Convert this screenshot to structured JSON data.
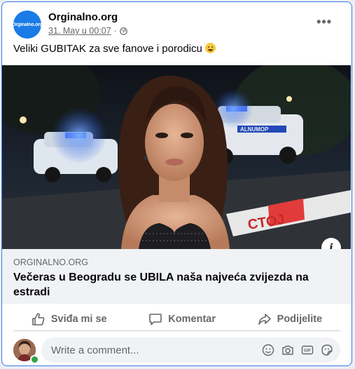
{
  "post": {
    "page_name": "Orginalno.org",
    "avatar_text": "Orginalno.org",
    "timestamp": "31. May u 00:07",
    "separator": "·",
    "more": "•••",
    "text": "Veliki GUBITAK za sve fanove i porodicu",
    "emoji": "grimacing-face"
  },
  "link": {
    "domain": "ORGINALNO.ORG",
    "title": "Večeras u Beogradu se UBILA naša najveća zvijezda na estradi",
    "tape_text": "CTOJ",
    "info": "i"
  },
  "actions": {
    "like": "Sviđa mi se",
    "comment": "Komentar",
    "share": "Podijelite"
  },
  "comment": {
    "placeholder": "Write a comment..."
  },
  "colors": {
    "accent": "#1a7be6",
    "muted": "#65676b",
    "online": "#31a24c"
  }
}
